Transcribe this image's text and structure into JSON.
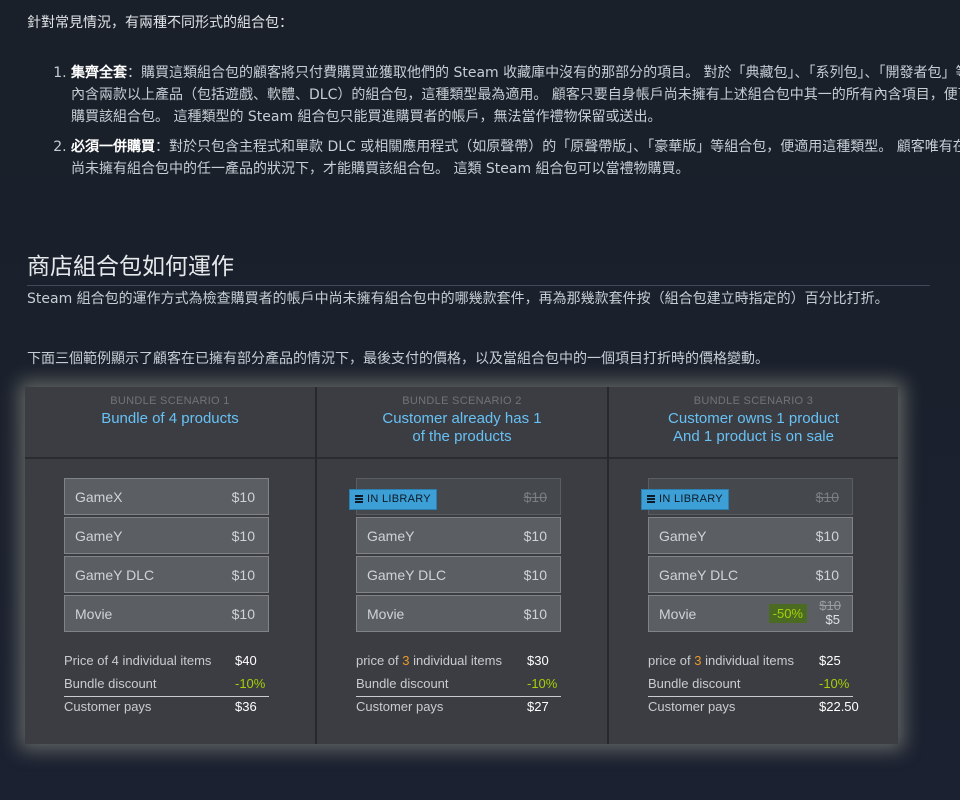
{
  "intro": "針對常見情況，有兩種不同形式的組合包：",
  "types": [
    {
      "title": "集齊全套",
      "text": "：購買這類組合包的顧客將只付費購買並獲取他們的 Steam 收藏庫中沒有的那部分的項目。 對於「典藏包」、「系列包」、「開發者包」等內含兩款以上產品（包括遊戲、軟體、DLC）的組合包，這種類型最為適用。 顧客只要自身帳戶尚未擁有上述組合包中其一的所有內含項目，便可購買該組合包。 這種類型的 Steam 組合包只能買進購買者的帳戶，無法當作禮物保留或送出。"
    },
    {
      "title": "必須一併購買",
      "text": "：對於只包含主程式和單款 DLC 或相關應用程式（如原聲帶）的「原聲帶版」、「豪華版」等組合包，便適用這種類型。 顧客唯有在尚未擁有組合包中的任一產品的狀況下，才能購買該組合包。 這類 Steam 組合包可以當禮物購買。"
    }
  ],
  "section_title": "商店組合包如何運作",
  "para1": "Steam 組合包的運作方式為檢查購買者的帳戶中尚未擁有組合包中的哪幾款套件，再為那幾款套件按（組合包建立時指定的）百分比打折。",
  "para2": "下面三個範例顯示了顧客在已擁有部分產品的情況下，最後支付的價格，以及當組合包中的一個項目打折時的價格變動。",
  "scenarios": [
    {
      "label": "BUNDLE SCENARIO 1",
      "title_line1": "Bundle of 4 products",
      "title_line2": "",
      "items": [
        {
          "name": "GameX",
          "price": "$10"
        },
        {
          "name": "GameY",
          "price": "$10"
        },
        {
          "name": "GameY DLC",
          "price": "$10"
        },
        {
          "name": "Movie",
          "price": "$10"
        }
      ],
      "price_label_pre": "Price of 4 individual items",
      "price_count": "",
      "price_label_post": "",
      "price_value": "$40",
      "discount_label": "Bundle discount",
      "discount_value": "-10%",
      "pays_label": "Customer pays",
      "pays_value": "$36"
    },
    {
      "label": "BUNDLE SCENARIO 2",
      "title_line1": "Customer already has 1",
      "title_line2": "of the products",
      "in_library_badge": "IN LIBRARY",
      "items": [
        {
          "name": "",
          "price": "$10"
        },
        {
          "name": "GameY",
          "price": "$10"
        },
        {
          "name": "GameY DLC",
          "price": "$10"
        },
        {
          "name": "Movie",
          "price": "$10"
        }
      ],
      "price_label_pre": "price of ",
      "price_count": "3",
      "price_label_post": " individual items",
      "price_value": "$30",
      "discount_label": "Bundle discount",
      "discount_value": "-10%",
      "pays_label": "Customer pays",
      "pays_value": "$27"
    },
    {
      "label": "BUNDLE SCENARIO 3",
      "title_line1": "Customer owns 1 product",
      "title_line2": "And 1 product is on sale",
      "in_library_badge": "IN LIBRARY",
      "items": [
        {
          "name": "",
          "price": "$10"
        },
        {
          "name": "GameY",
          "price": "$10"
        },
        {
          "name": "GameY DLC",
          "price": "$10"
        },
        {
          "name": "Movie",
          "sale": "-50%",
          "old_price": "$10",
          "new_price": "$5"
        }
      ],
      "price_label_pre": "price of ",
      "price_count": "3",
      "price_label_post": " individual items",
      "price_value": "$25",
      "discount_label": "Bundle discount",
      "discount_value": "-10%",
      "pays_label": "Customer pays",
      "pays_value": "$22.50"
    }
  ],
  "colors": {
    "accent_blue": "#67c1f5",
    "discount_green": "#a4d007",
    "count_orange": "#e89a2c",
    "badge_blue": "#3c9fd6"
  }
}
